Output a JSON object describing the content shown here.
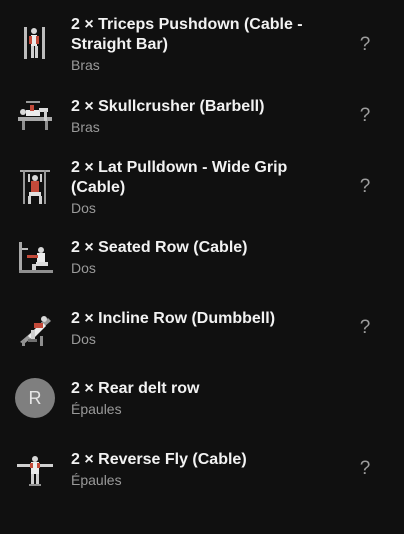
{
  "exercises": [
    {
      "title": "2 × Triceps Pushdown (Cable - Straight Bar)",
      "category": "Bras",
      "help": "?",
      "icon": "triceps-pushdown-icon"
    },
    {
      "title": "2 × Skullcrusher (Barbell)",
      "category": "Bras",
      "help": "?",
      "icon": "skullcrusher-icon"
    },
    {
      "title": "2 × Lat Pulldown - Wide Grip (Cable)",
      "category": "Dos",
      "help": "?",
      "icon": "lat-pulldown-icon"
    },
    {
      "title": "2 × Seated Row (Cable)",
      "category": "Dos",
      "help": "",
      "icon": "seated-row-icon"
    },
    {
      "title": "2 × Incline Row (Dumbbell)",
      "category": "Dos",
      "help": "?",
      "icon": "incline-row-icon"
    },
    {
      "title": "2 × Rear delt row",
      "category": "Épaules",
      "help": "",
      "avatar_letter": "R"
    },
    {
      "title": "2 × Reverse Fly (Cable)",
      "category": "Épaules",
      "help": "?",
      "icon": "reverse-fly-icon"
    }
  ]
}
